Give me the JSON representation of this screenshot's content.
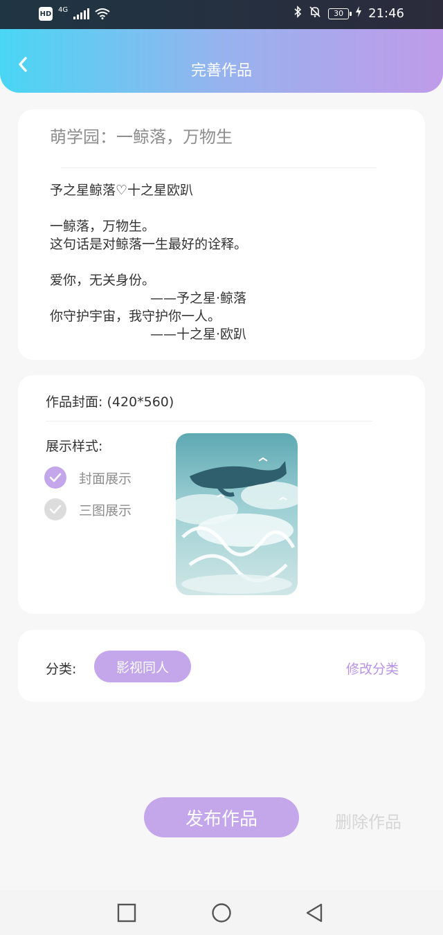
{
  "status_bar": {
    "hd_label": "HD",
    "network_label": "4G",
    "battery_level": "30",
    "time": "21:46"
  },
  "header": {
    "title": "完善作品"
  },
  "work": {
    "title": "萌学园：一鲸落，万物生",
    "body": "予之星鲸落♡十之星欧趴\n\n一鲸落，万物生。\n这句话是对鲸落一生最好的诠释。\n\n爱你，无关身份。\n                        ——予之星·鲸落\n你守护宇宙，我守护你一人。\n                        ——十之星·欧趴"
  },
  "cover": {
    "label": "作品封面: (420*560)",
    "style_label": "展示样式:",
    "options": [
      {
        "label": "封面展示",
        "selected": true
      },
      {
        "label": "三图展示",
        "selected": false
      }
    ]
  },
  "category": {
    "label": "分类:",
    "value": "影视同人",
    "edit_label": "修改分类"
  },
  "actions": {
    "publish_label": "发布作品",
    "delete_label": "删除作品"
  },
  "colors": {
    "accent": "#c4a6ea",
    "accent_text": "#b992e6",
    "header_gradient_start": "#49d6f4",
    "header_gradient_end": "#c09bea"
  }
}
